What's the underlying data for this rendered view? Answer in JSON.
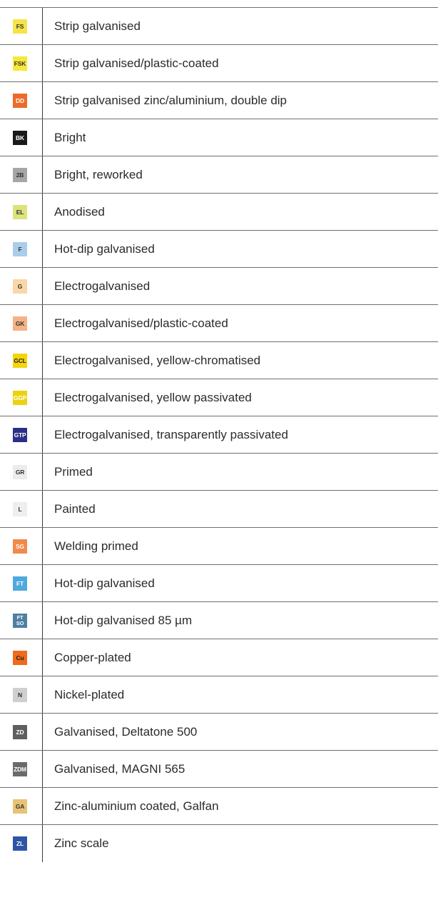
{
  "rows": [
    {
      "code": "FS",
      "description": "Strip galvanised",
      "bg": "#f5e34a",
      "fg": "#333333"
    },
    {
      "code": "FSK",
      "description": "Strip galvanised/plastic-coated",
      "bg": "#f8e83a",
      "fg": "#333333"
    },
    {
      "code": "DD",
      "description": "Strip galvanised zinc/aluminium, double dip",
      "bg": "#ec6a2a",
      "fg": "#ffffff"
    },
    {
      "code": "BK",
      "description": "Bright",
      "bg": "#1a1a1a",
      "fg": "#ffffff"
    },
    {
      "code": "2B",
      "description": "Bright, reworked",
      "bg": "#a6a6a6",
      "fg": "#333333"
    },
    {
      "code": "EL",
      "description": "Anodised",
      "bg": "#dbe37a",
      "fg": "#333333"
    },
    {
      "code": "F",
      "description": "Hot-dip galvanised",
      "bg": "#a9cdea",
      "fg": "#333333"
    },
    {
      "code": "G",
      "description": "Electrogalvanised",
      "bg": "#fbd6a6",
      "fg": "#333333"
    },
    {
      "code": "GK",
      "description": "Electrogalvanised/plastic-coated",
      "bg": "#f5b285",
      "fg": "#333333"
    },
    {
      "code": "GCL",
      "description": "Electrogalvanised, yellow-chromatised",
      "bg": "#f4d40c",
      "fg": "#222222"
    },
    {
      "code": "GGP",
      "description": "Electrogalvanised, yellow passivated",
      "bg": "#ecd20e",
      "fg": "#ffffff"
    },
    {
      "code": "GTP",
      "description": "Electrogalvanised, transparently passivated",
      "bg": "#2c2f86",
      "fg": "#ffffff"
    },
    {
      "code": "GR",
      "description": "Primed",
      "bg": "#ececec",
      "fg": "#333333"
    },
    {
      "code": "L",
      "description": "Painted",
      "bg": "#eeeeee",
      "fg": "#333333"
    },
    {
      "code": "SG",
      "description": "Welding primed",
      "bg": "#f08a4a",
      "fg": "#ffffff"
    },
    {
      "code": "FT",
      "description": "Hot-dip galvanised",
      "bg": "#4da9de",
      "fg": "#ffffff"
    },
    {
      "code": "FT\nSO",
      "description": "Hot-dip galvanised 85 µm",
      "bg": "#4d7fa3",
      "fg": "#ffffff"
    },
    {
      "code": "Cu",
      "description": "Copper-plated",
      "bg": "#ef6a1c",
      "fg": "#222222"
    },
    {
      "code": "N",
      "description": "Nickel-plated",
      "bg": "#cfcfcf",
      "fg": "#333333"
    },
    {
      "code": "ZD",
      "description": "Galvanised, Deltatone 500",
      "bg": "#5f5f5f",
      "fg": "#ffffff"
    },
    {
      "code": "ZDM",
      "description": "Galvanised, MAGNI 565",
      "bg": "#6a6a6a",
      "fg": "#ffffff"
    },
    {
      "code": "GA",
      "description": "Zinc-aluminium coated, Galfan",
      "bg": "#e7c373",
      "fg": "#333333"
    },
    {
      "code": "ZL",
      "description": "Zinc scale",
      "bg": "#2f56a6",
      "fg": "#ffffff"
    }
  ]
}
